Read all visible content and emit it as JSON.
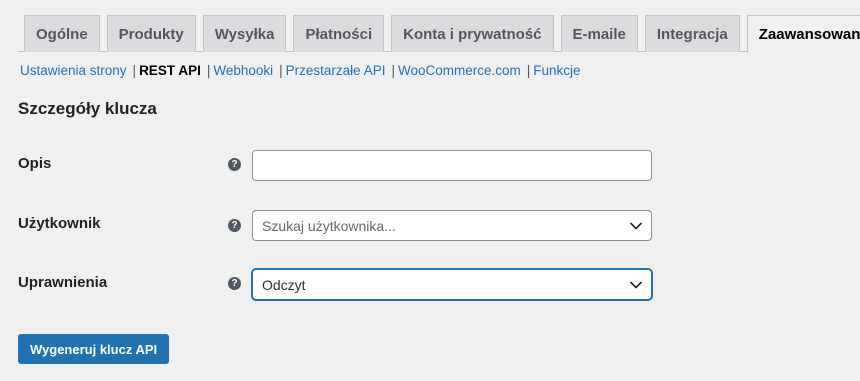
{
  "tabs": [
    {
      "label": "Ogólne"
    },
    {
      "label": "Produkty"
    },
    {
      "label": "Wysyłka"
    },
    {
      "label": "Płatności"
    },
    {
      "label": "Konta i prywatność"
    },
    {
      "label": "E-maile"
    },
    {
      "label": "Integracja"
    },
    {
      "label": "Zaawansowane",
      "active": true
    }
  ],
  "subnav": {
    "items": [
      {
        "label": "Ustawienia strony"
      },
      {
        "label": "REST API",
        "current": true
      },
      {
        "label": "Webhooki"
      },
      {
        "label": "Przestarzałe API"
      },
      {
        "label": "WooCommerce.com"
      },
      {
        "label": "Funkcje"
      }
    ],
    "separator": "|"
  },
  "section": {
    "title": "Szczegóły klucza"
  },
  "form": {
    "help_glyph": "?",
    "description": {
      "label": "Opis",
      "value": ""
    },
    "user": {
      "label": "Użytkownik",
      "placeholder": "Szukaj użytkownika..."
    },
    "permissions": {
      "label": "Uprawnienia",
      "value": "Odczyt"
    }
  },
  "button": {
    "label": "Wygeneruj klucz API"
  },
  "colors": {
    "accent": "#2271b1",
    "background": "#f0f0f1",
    "tab_bg": "#dcdcde"
  },
  "icons": [
    "help-icon",
    "chevron-down-icon"
  ]
}
